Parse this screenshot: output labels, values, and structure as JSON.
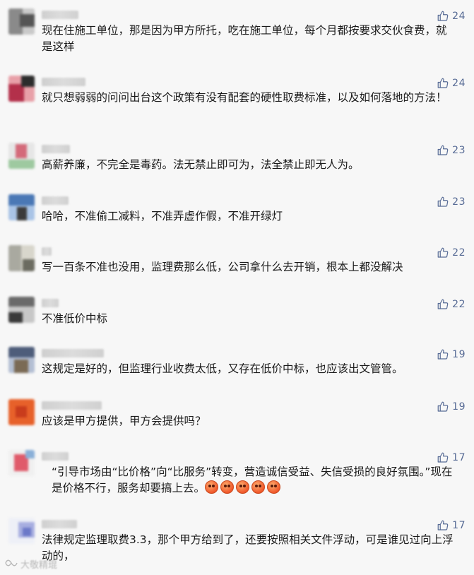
{
  "colors": {
    "background": "#f7f7f7",
    "like_blue": "#576b95",
    "text": "#1a1a1a"
  },
  "comments": [
    {
      "text": "现在住施工单位，那是因为甲方所托，吃在施工单位，每个月都按要求交伙食费，就是这样",
      "likes": "24",
      "avatar": [
        "#8a8a8a",
        "#c9c9c9",
        "#555"
      ]
    },
    {
      "text": "就只想弱弱的问问出台这个政策有没有配套的硬性取费标准，以及如何落地的方法！",
      "likes": "24",
      "avatar": [
        "#b3304a",
        "#e8a0a8",
        "#2c2c2c"
      ]
    },
    {
      "text": "高薪养廉，不完全是毒药。法无禁止即可为，法全禁止即无人为。",
      "likes": "23",
      "avatar": [
        "#e6e6e6",
        "#d46a7a",
        "#9ec9a0"
      ]
    },
    {
      "text": "哈哈，不准偷工减料，不准弄虚作假，不准开绿灯",
      "likes": "23",
      "avatar": [
        "#4a78b5",
        "#a9c4e6",
        "#3b3b3b"
      ]
    },
    {
      "text": "写一百条不准也没用，监理费那么低，公司拿什么去开销，根本上都没解决",
      "likes": "22",
      "avatar": [
        "#a9a9a0",
        "#d8d6cc",
        "#6b6b60"
      ]
    },
    {
      "text": "不准低价中标",
      "likes": "22",
      "avatar": [
        "#6a6a6a",
        "#c7c7c7",
        "#3a3a3a"
      ]
    },
    {
      "text": "这规定是好的，但监理行业收费太低，又存在低价中标，也应该出文管管。",
      "likes": "19",
      "avatar": [
        "#4e5d7a",
        "#b4bfd3",
        "#7a6a55"
      ]
    },
    {
      "text": "应该是甲方提供，甲方会提供吗？",
      "likes": "19",
      "avatar": [
        "#e7612a",
        "#f7b37a",
        "#c93c1c"
      ]
    },
    {
      "text": "“引导市场由“比价格”向“比服务”转变，营造诚信受益、失信受损的良好氛围。”现在是价格不行，服务却要搞上去。",
      "likes": "17",
      "avatar": [
        "#f0f0f0",
        "#e05a6a",
        "#8ab0d8"
      ]
    },
    {
      "text": "法律规定监理取费3.3，那个甲方给到了，还要按照相关文件浮动，可是谁见过向上浮动的，",
      "likes": "17",
      "avatar": [
        "#eef0f7",
        "#a7aee0",
        "#6c79c8"
      ]
    }
  ],
  "watermark": {
    "text": "大敬精琨",
    "icon": "wechat-channel-icon"
  },
  "icons": {
    "like": "thumbs-up-icon"
  }
}
